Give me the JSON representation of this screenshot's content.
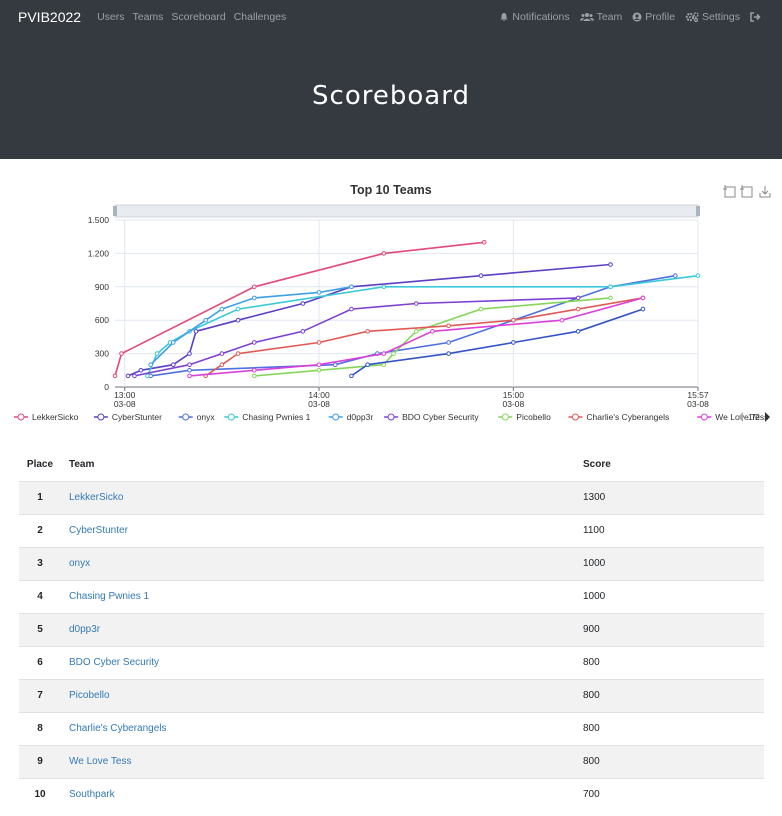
{
  "navbar": {
    "brand": "PVIB2022",
    "left": [
      "Users",
      "Teams",
      "Scoreboard",
      "Challenges"
    ],
    "right": [
      {
        "label": "Notifications",
        "icon": "bell-icon"
      },
      {
        "label": "Team",
        "icon": "users-icon"
      },
      {
        "label": "Profile",
        "icon": "user-circle-icon"
      },
      {
        "label": "Settings",
        "icon": "cogs-icon"
      },
      {
        "label": "",
        "icon": "logout-icon"
      }
    ]
  },
  "page": {
    "title": "Scoreboard"
  },
  "chart_data": {
    "type": "line",
    "title": "Top 10 Teams",
    "xlabel": "",
    "ylabel": "",
    "ylim": [
      0,
      1500
    ],
    "y_ticks": [
      "0",
      "300",
      "600",
      "900",
      "1.200",
      "1.500"
    ],
    "x_ticks": [
      {
        "time": "13:00",
        "date": "03-08"
      },
      {
        "time": "14:00",
        "date": "03-08"
      },
      {
        "time": "15:00",
        "date": "03-08"
      },
      {
        "time": "15:57",
        "date": "03-08"
      }
    ],
    "xlim": [
      "12:57",
      "15:57"
    ],
    "grid": true,
    "legend_position": "bottom",
    "legend_page": "1/2",
    "toolbox_icons": [
      "zoom-icon",
      "zoom-reset-icon",
      "download-icon"
    ],
    "series": [
      {
        "name": "LekkerSicko",
        "color": "#e5487a",
        "points": [
          [
            "12:57",
            100
          ],
          [
            "12:59",
            300
          ],
          [
            "13:40",
            900
          ],
          [
            "14:20",
            1200
          ],
          [
            "14:51",
            1300
          ]
        ]
      },
      {
        "name": "CyberStunter",
        "color": "#5b3fc4",
        "points": [
          [
            "13:01",
            100
          ],
          [
            "13:05",
            150
          ],
          [
            "13:15",
            200
          ],
          [
            "13:20",
            300
          ],
          [
            "13:22",
            500
          ],
          [
            "13:35",
            600
          ],
          [
            "13:55",
            750
          ],
          [
            "14:10",
            900
          ],
          [
            "14:50",
            1000
          ],
          [
            "15:30",
            1100
          ]
        ]
      },
      {
        "name": "onyx",
        "color": "#4f6fe0",
        "points": [
          [
            "13:08",
            100
          ],
          [
            "13:20",
            150
          ],
          [
            "14:05",
            200
          ],
          [
            "14:18",
            300
          ],
          [
            "14:40",
            400
          ],
          [
            "15:00",
            600
          ],
          [
            "15:30",
            900
          ],
          [
            "15:50",
            1000
          ]
        ]
      },
      {
        "name": "Chasing Pwnies 1",
        "color": "#39c9d9",
        "points": [
          [
            "13:07",
            100
          ],
          [
            "13:10",
            300
          ],
          [
            "13:14",
            400
          ],
          [
            "13:20",
            500
          ],
          [
            "13:35",
            700
          ],
          [
            "14:20",
            900
          ],
          [
            "15:30",
            900
          ],
          [
            "15:57",
            1000
          ]
        ]
      },
      {
        "name": "d0pp3r",
        "color": "#3fa0e4",
        "points": [
          [
            "13:08",
            200
          ],
          [
            "13:15",
            400
          ],
          [
            "13:25",
            600
          ],
          [
            "13:30",
            700
          ],
          [
            "13:40",
            800
          ],
          [
            "14:00",
            850
          ],
          [
            "14:10",
            900
          ]
        ]
      },
      {
        "name": "BDO Cyber Security",
        "color": "#7d40d2",
        "points": [
          [
            "13:03",
            100
          ],
          [
            "13:20",
            200
          ],
          [
            "13:30",
            300
          ],
          [
            "13:40",
            400
          ],
          [
            "13:55",
            500
          ],
          [
            "14:10",
            700
          ],
          [
            "14:30",
            750
          ],
          [
            "15:20",
            800
          ]
        ]
      },
      {
        "name": "Picobello",
        "color": "#86d65a",
        "points": [
          [
            "13:40",
            100
          ],
          [
            "14:00",
            150
          ],
          [
            "14:20",
            200
          ],
          [
            "14:23",
            300
          ],
          [
            "14:30",
            500
          ],
          [
            "14:50",
            700
          ],
          [
            "15:30",
            800
          ]
        ]
      },
      {
        "name": "Charlie's Cyberangels",
        "color": "#e05a55",
        "points": [
          [
            "13:25",
            100
          ],
          [
            "13:30",
            200
          ],
          [
            "13:35",
            300
          ],
          [
            "14:00",
            400
          ],
          [
            "14:15",
            500
          ],
          [
            "14:40",
            550
          ],
          [
            "15:00",
            600
          ],
          [
            "15:20",
            700
          ],
          [
            "15:40",
            800
          ]
        ]
      },
      {
        "name": "We Love Tess",
        "color": "#db40db",
        "points": [
          [
            "13:20",
            100
          ],
          [
            "13:40",
            150
          ],
          [
            "14:00",
            200
          ],
          [
            "14:20",
            300
          ],
          [
            "14:35",
            500
          ],
          [
            "15:15",
            600
          ],
          [
            "15:40",
            800
          ]
        ]
      },
      {
        "name": "Southpark",
        "color": "#3553c8",
        "points": [
          [
            "14:10",
            100
          ],
          [
            "14:15",
            200
          ],
          [
            "14:40",
            300
          ],
          [
            "15:00",
            400
          ],
          [
            "15:20",
            500
          ],
          [
            "15:40",
            700
          ]
        ]
      }
    ]
  },
  "table": {
    "headers": {
      "place": "Place",
      "team": "Team",
      "score": "Score"
    },
    "rows": [
      {
        "place": "1",
        "team": "LekkerSicko",
        "score": "1300"
      },
      {
        "place": "2",
        "team": "CyberStunter",
        "score": "1100"
      },
      {
        "place": "3",
        "team": "onyx",
        "score": "1000"
      },
      {
        "place": "4",
        "team": "Chasing Pwnies 1",
        "score": "1000"
      },
      {
        "place": "5",
        "team": "d0pp3r",
        "score": "900"
      },
      {
        "place": "6",
        "team": "BDO Cyber Security",
        "score": "800"
      },
      {
        "place": "7",
        "team": "Picobello",
        "score": "800"
      },
      {
        "place": "8",
        "team": "Charlie's Cyberangels",
        "score": "800"
      },
      {
        "place": "9",
        "team": "We Love Tess",
        "score": "800"
      },
      {
        "place": "10",
        "team": "Southpark",
        "score": "700"
      }
    ]
  }
}
